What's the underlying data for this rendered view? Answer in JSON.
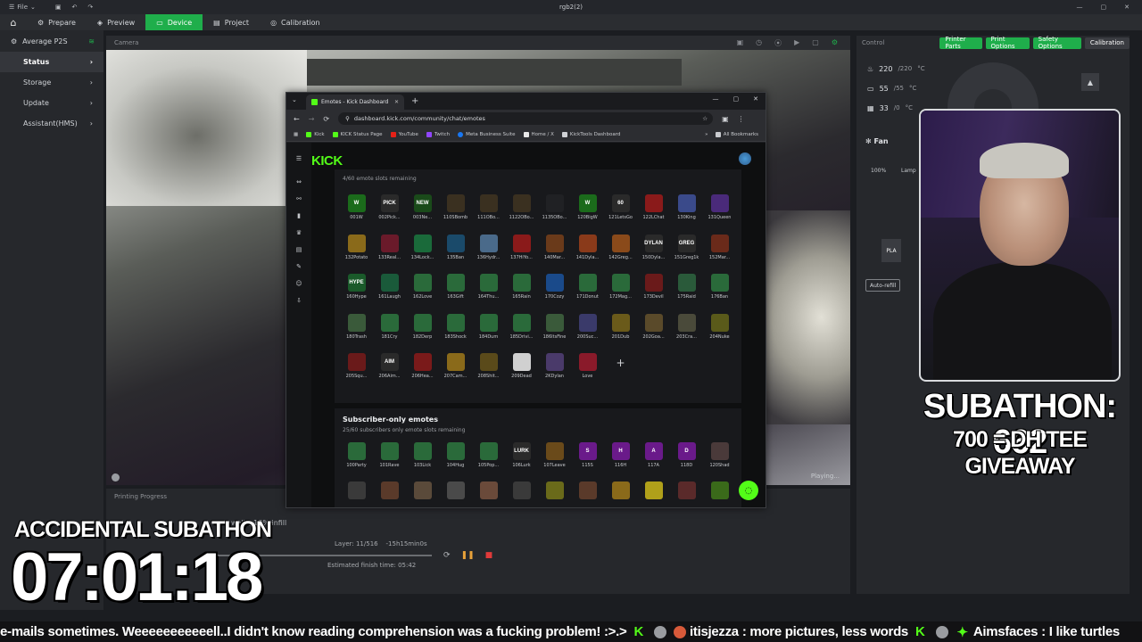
{
  "titlebar": {
    "menu_label": "File",
    "doc_title": "rgb2(2)"
  },
  "nav": {
    "tabs": [
      {
        "label": "Prepare"
      },
      {
        "label": "Preview"
      },
      {
        "label": "Device"
      },
      {
        "label": "Project"
      },
      {
        "label": "Calibration"
      }
    ],
    "active_tab": "Device"
  },
  "sidebar": {
    "printer": "Average P2S",
    "items": [
      {
        "label": "Status"
      },
      {
        "label": "Storage"
      },
      {
        "label": "Update"
      },
      {
        "label": "Assistant(HMS)"
      }
    ]
  },
  "camera": {
    "header": "Camera",
    "status": "Playing..."
  },
  "progress": {
    "header": "Printing Progress",
    "infill_text": "walls, 15% infill",
    "layer_text": "Layer: 11/516",
    "remaining_text": "-15h15min0s",
    "finish_text": "Estimated finish time: 05:42",
    "percent": 2
  },
  "control": {
    "header": "Control",
    "buttons": [
      "Printer Parts",
      "Print Options",
      "Safety Options",
      "Calibration"
    ],
    "temps": [
      {
        "current": "220",
        "target": "/220",
        "unit": "°C"
      },
      {
        "current": "55",
        "target": "/55",
        "unit": "°C"
      },
      {
        "current": "33",
        "target": "/0",
        "unit": "°C"
      }
    ],
    "fan_label": "Fan",
    "fan_pct": "100%",
    "lamp_label": "Lamp",
    "filament": "PLA",
    "auto_refill": "Auto-refill"
  },
  "browser": {
    "tab_title": "Emotes - Kick Dashboard",
    "url": "dashboard.kick.com/community/chat/emotes",
    "bookmarks": [
      "Kick",
      "KICK Status Page",
      "YouTube",
      "Twitch",
      "Meta Business Suite",
      "Home / X",
      "KickTools Dashboard"
    ],
    "all_bookmarks": "All Bookmarks"
  },
  "kick": {
    "logo": "KICK",
    "slots_note": "4/60 emote slots remaining",
    "emotes": [
      {
        "name": "001W",
        "color": "#1b6b1b",
        "glyph": "W"
      },
      {
        "name": "002Pick...",
        "color": "#2a2a2a",
        "glyph": "PICK"
      },
      {
        "name": "003Ne...",
        "color": "#1a4a1a",
        "glyph": "NEW"
      },
      {
        "name": "110SBomb",
        "color": "#3a3020",
        "glyph": ""
      },
      {
        "name": "111OBo...",
        "color": "#3a3020",
        "glyph": ""
      },
      {
        "name": "1122OBo...",
        "color": "#3a3020",
        "glyph": ""
      },
      {
        "name": "1135OBo...",
        "color": "#202124",
        "glyph": ""
      },
      {
        "name": "120BigW",
        "color": "#1b6b1b",
        "glyph": "W"
      },
      {
        "name": "121LetsGo",
        "color": "#2a2a2a",
        "glyph": "60"
      },
      {
        "name": "122LChat",
        "color": "#8a1a1a",
        "glyph": ""
      },
      {
        "name": "130King",
        "color": "#3a4a8a",
        "glyph": ""
      },
      {
        "name": "131Queen",
        "color": "#4a2a7a",
        "glyph": ""
      },
      {
        "name": "132Potato",
        "color": "#8a6a1a",
        "glyph": ""
      },
      {
        "name": "133Real...",
        "color": "#6a1a2a",
        "glyph": ""
      },
      {
        "name": "134Lock...",
        "color": "#1a6a3a",
        "glyph": ""
      },
      {
        "name": "135Ban",
        "color": "#1a4a6a",
        "glyph": ""
      },
      {
        "name": "136Hydr...",
        "color": "#4a6a8a",
        "glyph": ""
      },
      {
        "name": "137HiYo...",
        "color": "#8a1a1a",
        "glyph": ""
      },
      {
        "name": "140Mar...",
        "color": "#6a3a1a",
        "glyph": ""
      },
      {
        "name": "141Dyla...",
        "color": "#8a3a1a",
        "glyph": ""
      },
      {
        "name": "142Greg...",
        "color": "#8a4a1a",
        "glyph": ""
      },
      {
        "name": "150Dyla...",
        "color": "#2a2a2a",
        "glyph": "DYLAN"
      },
      {
        "name": "151Greg1k",
        "color": "#2a2a2a",
        "glyph": "GREG"
      },
      {
        "name": "152Mar...",
        "color": "#6a2a1a",
        "glyph": ""
      },
      {
        "name": "160Hype",
        "color": "#1a5a2a",
        "glyph": "HYPE"
      },
      {
        "name": "161Laugh",
        "color": "#1a5a3a",
        "glyph": ""
      },
      {
        "name": "162Love",
        "color": "#2a6a3a",
        "glyph": ""
      },
      {
        "name": "163Gift",
        "color": "#2a6a3a",
        "glyph": ""
      },
      {
        "name": "164Thu...",
        "color": "#2a6a3a",
        "glyph": ""
      },
      {
        "name": "165Rain",
        "color": "#2a6a3a",
        "glyph": ""
      },
      {
        "name": "170Cozy",
        "color": "#1a4a8a",
        "glyph": ""
      },
      {
        "name": "171Donut",
        "color": "#2a6a3a",
        "glyph": ""
      },
      {
        "name": "172Mag...",
        "color": "#2a6a3a",
        "glyph": ""
      },
      {
        "name": "173Devil",
        "color": "#6a1a1a",
        "glyph": ""
      },
      {
        "name": "175Raid",
        "color": "#2a5a3a",
        "glyph": ""
      },
      {
        "name": "176Ban",
        "color": "#2a6a3a",
        "glyph": ""
      },
      {
        "name": "180Trash",
        "color": "#3a5a3a",
        "glyph": ""
      },
      {
        "name": "181Cry",
        "color": "#2a6a3a",
        "glyph": ""
      },
      {
        "name": "182Derp",
        "color": "#2a6a3a",
        "glyph": ""
      },
      {
        "name": "183Shock",
        "color": "#2a6a3a",
        "glyph": ""
      },
      {
        "name": "184Dum",
        "color": "#2a6a3a",
        "glyph": ""
      },
      {
        "name": "185Drivi...",
        "color": "#2a6a3a",
        "glyph": ""
      },
      {
        "name": "186ItsFine",
        "color": "#3a5a3a",
        "glyph": ""
      },
      {
        "name": "200Suc...",
        "color": "#3a3a6a",
        "glyph": ""
      },
      {
        "name": "201Dub",
        "color": "#6a5a1a",
        "glyph": ""
      },
      {
        "name": "202Goa...",
        "color": "#5a4a2a",
        "glyph": ""
      },
      {
        "name": "203Cra...",
        "color": "#4a4a3a",
        "glyph": ""
      },
      {
        "name": "204Nuke",
        "color": "#5a5a1a",
        "glyph": ""
      },
      {
        "name": "205Squ...",
        "color": "#6a1a1a",
        "glyph": ""
      },
      {
        "name": "206Aim...",
        "color": "#2a2a2a",
        "glyph": "AIM"
      },
      {
        "name": "206Hea...",
        "color": "#7a1a1a",
        "glyph": ""
      },
      {
        "name": "207Cam...",
        "color": "#8a6a1a",
        "glyph": ""
      },
      {
        "name": "208Shit...",
        "color": "#5a4a1a",
        "glyph": ""
      },
      {
        "name": "209Dead",
        "color": "#d0d0d0",
        "glyph": ""
      },
      {
        "name": "2KDylan",
        "color": "#4a3a6a",
        "glyph": ""
      },
      {
        "name": "Love",
        "color": "#8a1a2a",
        "glyph": ""
      }
    ],
    "sub_title": "Subscriber-only emotes",
    "sub_slots": "25/60 subscribers only emote slots remaining",
    "sub_emotes": [
      {
        "name": "100Party",
        "color": "#2a6a3a",
        "glyph": ""
      },
      {
        "name": "101Rave",
        "color": "#2a6a3a",
        "glyph": ""
      },
      {
        "name": "103Lick",
        "color": "#2a6a3a",
        "glyph": ""
      },
      {
        "name": "104Hug",
        "color": "#2a6a3a",
        "glyph": ""
      },
      {
        "name": "105Pop...",
        "color": "#2a6a3a",
        "glyph": ""
      },
      {
        "name": "106Lurk",
        "color": "#2a2a2a",
        "glyph": "LURK"
      },
      {
        "name": "107Leave",
        "color": "#6a4a1a",
        "glyph": ""
      },
      {
        "name": "115S",
        "color": "#6a1a8a",
        "glyph": "S"
      },
      {
        "name": "116H",
        "color": "#6a1a8a",
        "glyph": "H"
      },
      {
        "name": "117A",
        "color": "#6a1a8a",
        "glyph": "A"
      },
      {
        "name": "118D",
        "color": "#6a1a8a",
        "glyph": "D"
      },
      {
        "name": "120Shad",
        "color": "#4a3a3a",
        "glyph": ""
      },
      {
        "name": "",
        "color": "#3a3a3a",
        "glyph": ""
      },
      {
        "name": "",
        "color": "#5a3a2a",
        "glyph": ""
      },
      {
        "name": "",
        "color": "#5a4a3a",
        "glyph": ""
      },
      {
        "name": "",
        "color": "#4a4a4a",
        "glyph": ""
      },
      {
        "name": "",
        "color": "#6a4a3a",
        "glyph": ""
      },
      {
        "name": "",
        "color": "#3a3a3a",
        "glyph": ""
      },
      {
        "name": "",
        "color": "#6a6a1a",
        "glyph": ""
      },
      {
        "name": "",
        "color": "#5a3a2a",
        "glyph": ""
      },
      {
        "name": "",
        "color": "#8a6a1a",
        "glyph": ""
      },
      {
        "name": "",
        "color": "#b0a01a",
        "glyph": ""
      },
      {
        "name": "",
        "color": "#5a2a2a",
        "glyph": ""
      },
      {
        "name": "",
        "color": "#3a6a1a",
        "glyph": ""
      }
    ]
  },
  "overlay": {
    "subathon": "SUBATHON: 662",
    "giveaway": "700 = DH TEE GIVEAWAY",
    "accidental": "ACCIDENTAL SUBATHON",
    "timer": "07:01:18"
  },
  "ticker": {
    "msg1": "e-mails sometimes. Weeeeeeeeeeell..I didn't know reading comprehension was a fucking problem! :>.>",
    "user1": "itisjezza",
    "msg2": ": more pictures, less words",
    "user2": "Aimsfaces",
    "msg3": ": I like turtles"
  },
  "colors": {
    "accent": "#1fae4b",
    "kick_green": "#53fc18"
  }
}
